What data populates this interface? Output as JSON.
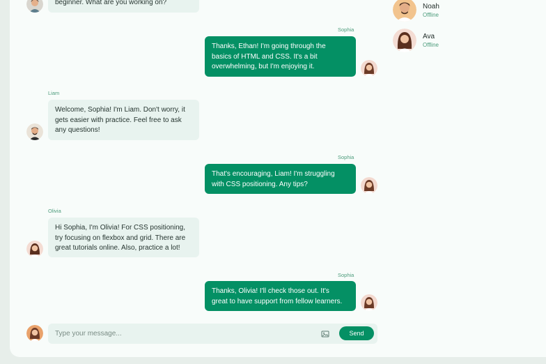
{
  "messages": [
    {
      "sender": "",
      "text": "beginner. What are you working on?"
    },
    {
      "sender": "Sophia",
      "text": "Thanks, Ethan! I'm going through the\nbasics of HTML and CSS. It's a bit\noverwhelming, but I'm enjoying it."
    },
    {
      "sender": "Liam",
      "text": "Welcome, Sophia! I'm Liam. Don't worry, it\ngets easier with practice. Feel free to ask\nany questions!"
    },
    {
      "sender": "Sophia",
      "text": "That's encouraging, Liam! I'm struggling\nwith CSS positioning. Any tips?"
    },
    {
      "sender": "Olivia",
      "text": "Hi Sophia, I'm Olivia! For CSS positioning,\ntry focusing on flexbox and grid. There are\ngreat tutorials online. Also, practice a lot!"
    },
    {
      "sender": "Sophia",
      "text": "Thanks, Olivia! I'll check those out. It's\ngreat to have support from fellow learners."
    }
  ],
  "contacts": [
    {
      "name": "Noah",
      "status": "Offline"
    },
    {
      "name": "Ava",
      "status": "Offline"
    }
  ],
  "composer": {
    "placeholder": "Type your message...",
    "send_label": "Send"
  },
  "colors": {
    "accent": "#049064",
    "incoming_bubble": "#e8f3ef",
    "status_text": "#4d9c7c"
  },
  "icons": {
    "attach": "image-icon"
  }
}
